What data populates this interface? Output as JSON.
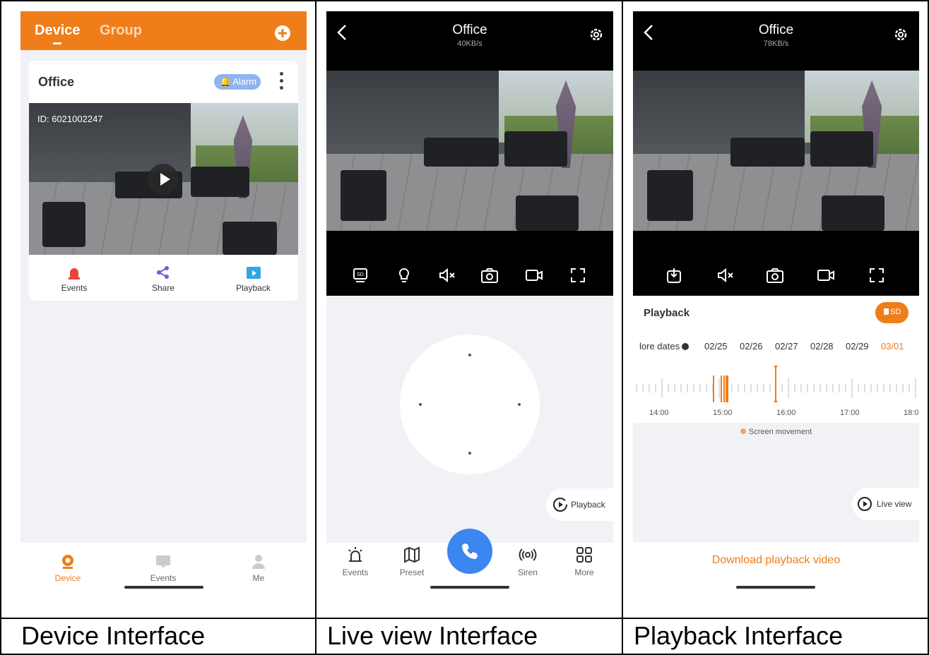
{
  "panel1": {
    "tabs": [
      "Device",
      "Group"
    ],
    "card_title": "Office",
    "alarm_label": "Alarm",
    "cam_id": "ID: 6021002247",
    "actions": [
      "Events",
      "Share",
      "Playback"
    ],
    "bottom_nav": [
      "Device",
      "Events",
      "Me"
    ],
    "caption": "Device Interface"
  },
  "panel2": {
    "title": "Office",
    "speed": "40KB/s",
    "playback_btn": "Playback",
    "bottom_nav": [
      "Events",
      "Preset",
      "Siren",
      "More"
    ],
    "caption": "Live view Interface",
    "sd_label": "SD"
  },
  "panel3": {
    "title": "Office",
    "speed": "78KB/s",
    "playback_label": "Playback",
    "sd_label": "SD",
    "more_dates": "lore dates",
    "dates": [
      "02/25",
      "02/26",
      "02/27",
      "02/28",
      "02/29",
      "03/01"
    ],
    "times": [
      "14:00",
      "15:00",
      "16:00",
      "17:00",
      "18:0"
    ],
    "legend": "Screen movement",
    "live_view_btn": "Live view",
    "download": "Download playback video",
    "caption": "Playback Interface"
  },
  "colors": {
    "accent": "#ee7d1a",
    "blue": "#3b86f0",
    "alarm": "#8fb4ef"
  }
}
